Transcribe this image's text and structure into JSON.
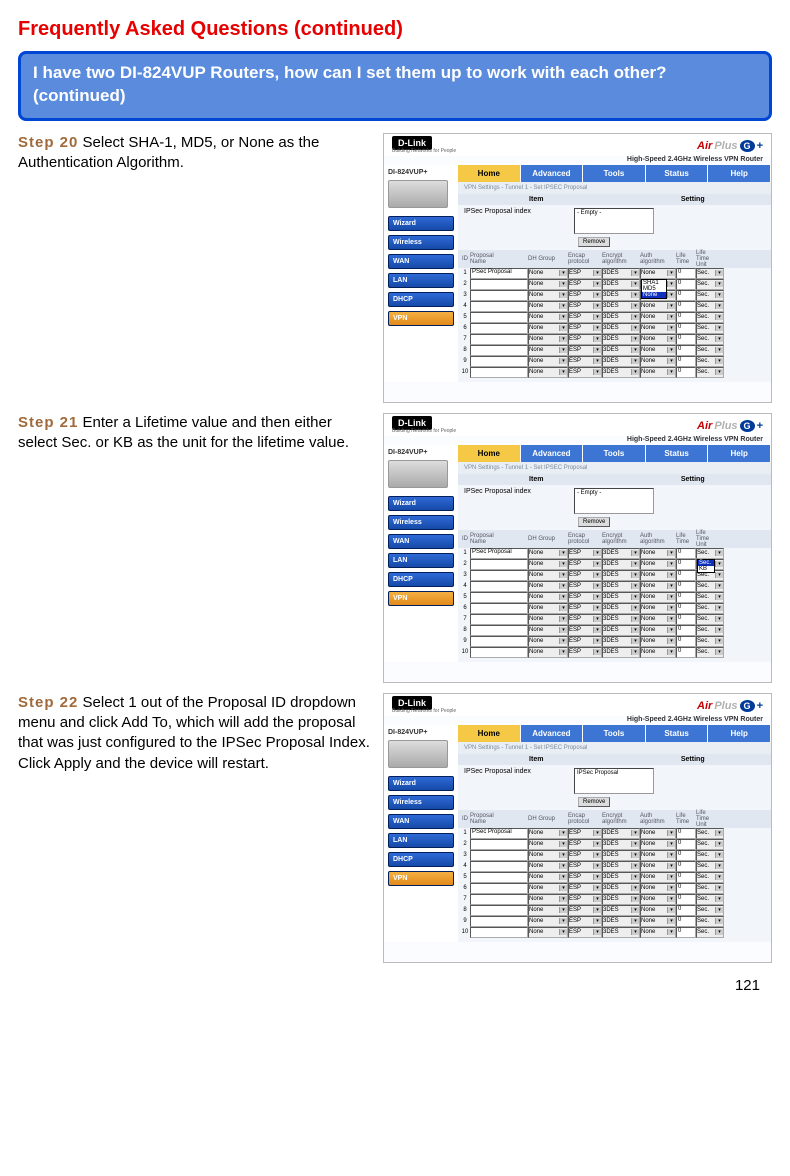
{
  "faq_heading": "Frequently Asked Questions (continued)",
  "question_box": "I have two DI-824VUP Routers, how can I set them up to work with each other? (continued)",
  "page_number": "121",
  "step20": {
    "label": "Step 20",
    "text": " Select SHA-1, MD5, or None as the Authentication Algorithm."
  },
  "step21": {
    "label": "Step 21",
    "text": " Enter a Lifetime value and then either select Sec. or KB as the unit for the lifetime value."
  },
  "step22": {
    "label": "Step 22",
    "text": " Select 1 out of the Proposal ID dropdown menu and click Add To, which will add the proposal that was just configured to the IPSec Proposal Index. Click Apply and the device will restart."
  },
  "router_common": {
    "logo": "D-Link",
    "logo_sub": "Building Networks for People",
    "brand_air": "Air",
    "brand_plus": "Plus",
    "brand_g": "G",
    "brand_pl": "+",
    "subtitle": "High-Speed 2.4GHz Wireless VPN Router",
    "model": "DI-824VUP+",
    "tabs": [
      "Home",
      "Advanced",
      "Tools",
      "Status",
      "Help"
    ],
    "nav": [
      "Wizard",
      "Wireless",
      "WAN",
      "LAN",
      "DHCP",
      "VPN"
    ],
    "breadcrumb": "VPN Settings - Tunnel 1 - Set IPSEC Proposal",
    "item_hdr": "Item",
    "setting_hdr": "Setting",
    "index_label": "IPSec Proposal index",
    "empty_box": "- Empty -",
    "remove": "Remove",
    "cols": {
      "id": "ID",
      "name": "Proposal\nName",
      "dh": "DH Group",
      "encap": "Encap\nprotocol",
      "enc": "Encrypt\nalgorithm",
      "auth": "Auth\nalgorithm",
      "life": "Life\nTime",
      "unit": "Life\nTime\nUnit"
    }
  },
  "shot1": {
    "rows": [
      {
        "id": "1",
        "name": "PSec Proposal",
        "dh": "None",
        "encap": "ESP",
        "enc": "3DES",
        "auth": "None",
        "life": "0",
        "unit": "Sec."
      },
      {
        "id": "2",
        "name": "",
        "dh": "None",
        "encap": "ESP",
        "enc": "3DES",
        "auth": "",
        "life": "0",
        "unit": "Sec."
      },
      {
        "id": "3",
        "name": "",
        "dh": "None",
        "encap": "ESP",
        "enc": "3DES",
        "auth": "",
        "life": "0",
        "unit": "Sec."
      },
      {
        "id": "4",
        "name": "",
        "dh": "None",
        "encap": "ESP",
        "enc": "3DES",
        "auth": "None",
        "life": "0",
        "unit": "Sec."
      },
      {
        "id": "5",
        "name": "",
        "dh": "None",
        "encap": "ESP",
        "enc": "3DES",
        "auth": "None",
        "life": "0",
        "unit": "Sec."
      },
      {
        "id": "6",
        "name": "",
        "dh": "None",
        "encap": "ESP",
        "enc": "3DES",
        "auth": "None",
        "life": "0",
        "unit": "Sec."
      },
      {
        "id": "7",
        "name": "",
        "dh": "None",
        "encap": "ESP",
        "enc": "3DES",
        "auth": "None",
        "life": "0",
        "unit": "Sec."
      },
      {
        "id": "8",
        "name": "",
        "dh": "None",
        "encap": "ESP",
        "enc": "3DES",
        "auth": "None",
        "life": "0",
        "unit": "Sec."
      },
      {
        "id": "9",
        "name": "",
        "dh": "None",
        "encap": "ESP",
        "enc": "3DES",
        "auth": "None",
        "life": "0",
        "unit": "Sec."
      },
      {
        "id": "10",
        "name": "",
        "dh": "None",
        "encap": "ESP",
        "enc": "3DES",
        "auth": "None",
        "life": "0",
        "unit": "Sec."
      }
    ],
    "auth_dropdown": {
      "opts": [
        "SHA1",
        "MD5",
        "None"
      ],
      "sel": "None"
    }
  },
  "shot2": {
    "rows": [
      {
        "id": "1",
        "name": "PSec Proposal",
        "dh": "None",
        "encap": "ESP",
        "enc": "3DES",
        "auth": "None",
        "life": "0",
        "unit": "Sec."
      },
      {
        "id": "2",
        "name": "",
        "dh": "None",
        "encap": "ESP",
        "enc": "3DES",
        "auth": "None",
        "life": "0",
        "unit": ""
      },
      {
        "id": "3",
        "name": "",
        "dh": "None",
        "encap": "ESP",
        "enc": "3DES",
        "auth": "None",
        "life": "0",
        "unit": "Sec."
      },
      {
        "id": "4",
        "name": "",
        "dh": "None",
        "encap": "ESP",
        "enc": "3DES",
        "auth": "None",
        "life": "0",
        "unit": "Sec."
      },
      {
        "id": "5",
        "name": "",
        "dh": "None",
        "encap": "ESP",
        "enc": "3DES",
        "auth": "None",
        "life": "0",
        "unit": "Sec."
      },
      {
        "id": "6",
        "name": "",
        "dh": "None",
        "encap": "ESP",
        "enc": "3DES",
        "auth": "None",
        "life": "0",
        "unit": "Sec."
      },
      {
        "id": "7",
        "name": "",
        "dh": "None",
        "encap": "ESP",
        "enc": "3DES",
        "auth": "None",
        "life": "0",
        "unit": "Sec."
      },
      {
        "id": "8",
        "name": "",
        "dh": "None",
        "encap": "ESP",
        "enc": "3DES",
        "auth": "None",
        "life": "0",
        "unit": "Sec."
      },
      {
        "id": "9",
        "name": "",
        "dh": "None",
        "encap": "ESP",
        "enc": "3DES",
        "auth": "None",
        "life": "0",
        "unit": "Sec."
      },
      {
        "id": "10",
        "name": "",
        "dh": "None",
        "encap": "ESP",
        "enc": "3DES",
        "auth": "None",
        "life": "0",
        "unit": "Sec."
      }
    ],
    "unit_dropdown": {
      "opts": [
        "Sec.",
        "KB"
      ],
      "sel": "Sec."
    }
  },
  "shot3": {
    "index_box": "IPSec Proposal",
    "rows": [
      {
        "id": "1",
        "name": "PSec Proposal",
        "dh": "None",
        "encap": "ESP",
        "enc": "3DES",
        "auth": "None",
        "life": "0",
        "unit": "Sec."
      },
      {
        "id": "2",
        "name": "",
        "dh": "None",
        "encap": "ESP",
        "enc": "3DES",
        "auth": "None",
        "life": "0",
        "unit": "Sec."
      },
      {
        "id": "3",
        "name": "",
        "dh": "None",
        "encap": "ESP",
        "enc": "3DES",
        "auth": "None",
        "life": "0",
        "unit": "Sec."
      },
      {
        "id": "4",
        "name": "",
        "dh": "None",
        "encap": "ESP",
        "enc": "3DES",
        "auth": "None",
        "life": "0",
        "unit": "Sec."
      },
      {
        "id": "5",
        "name": "",
        "dh": "None",
        "encap": "ESP",
        "enc": "3DES",
        "auth": "None",
        "life": "0",
        "unit": "Sec."
      },
      {
        "id": "6",
        "name": "",
        "dh": "None",
        "encap": "ESP",
        "enc": "3DES",
        "auth": "None",
        "life": "0",
        "unit": "Sec."
      },
      {
        "id": "7",
        "name": "",
        "dh": "None",
        "encap": "ESP",
        "enc": "3DES",
        "auth": "None",
        "life": "0",
        "unit": "Sec."
      },
      {
        "id": "8",
        "name": "",
        "dh": "None",
        "encap": "ESP",
        "enc": "3DES",
        "auth": "None",
        "life": "0",
        "unit": "Sec."
      },
      {
        "id": "9",
        "name": "",
        "dh": "None",
        "encap": "ESP",
        "enc": "3DES",
        "auth": "None",
        "life": "0",
        "unit": "Sec."
      },
      {
        "id": "10",
        "name": "",
        "dh": "None",
        "encap": "ESP",
        "enc": "3DES",
        "auth": "None",
        "life": "0",
        "unit": "Sec."
      }
    ]
  }
}
